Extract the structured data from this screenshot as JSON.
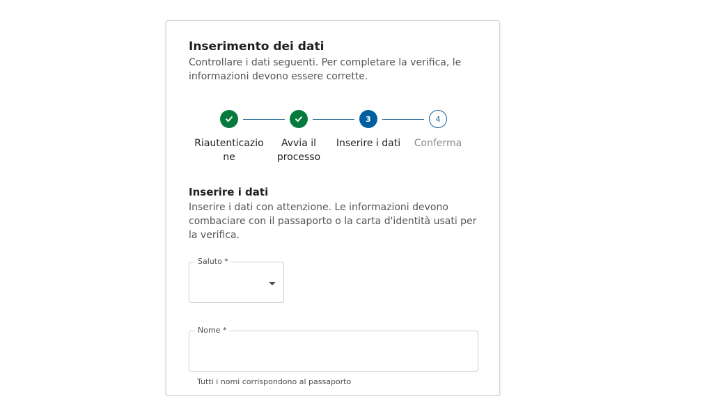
{
  "header": {
    "title": "Inserimento dei dati",
    "subtitle": "Controllare i dati seguenti. Per completare la verifica, le informazioni devono essere corrette."
  },
  "stepper": {
    "steps": [
      {
        "label": "Riautenticazione",
        "number": "1",
        "status": "done"
      },
      {
        "label": "Avvia il processo",
        "number": "2",
        "status": "done"
      },
      {
        "label": "Inserire i dati",
        "number": "3",
        "status": "active"
      },
      {
        "label": "Conferma",
        "number": "4",
        "status": "pending"
      }
    ],
    "colors": {
      "done": "#047a3c",
      "active": "#005f9e",
      "pending_border": "#0e5f8f",
      "connector": "#0e5f8f"
    }
  },
  "section": {
    "title": "Inserire i dati",
    "description": "Inserire i dati con attenzione. Le informazioni devono combaciare con il passaporto o la carta d'identità usati per la verifica."
  },
  "form": {
    "salutation": {
      "label": "Saluto *",
      "value": "",
      "icon": "chevron-down-icon"
    },
    "first_name": {
      "label": "Nome *",
      "value": "",
      "hint": "Tutti i nomi corrispondono al passaporto"
    }
  }
}
